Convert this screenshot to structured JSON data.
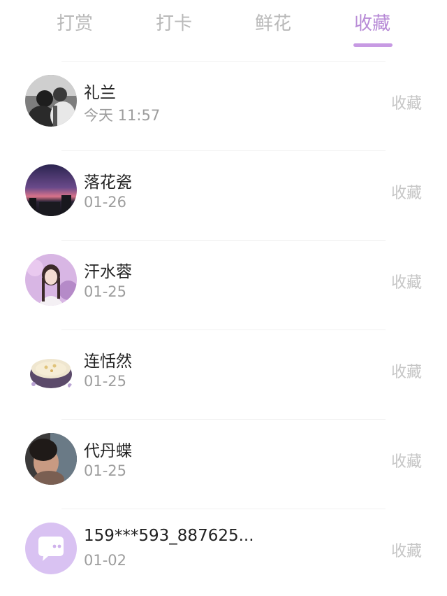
{
  "tabs": [
    {
      "label": "打赏",
      "active": false
    },
    {
      "label": "打卡",
      "active": false
    },
    {
      "label": "鲜花",
      "active": false
    },
    {
      "label": "收藏",
      "active": true
    }
  ],
  "colors": {
    "accent": "#c79ae3",
    "active_tab_text": "#b78ad6",
    "inactive_tab_text": "#b9b9b9",
    "name_text": "#222222",
    "date_text": "#9d9d9d",
    "action_text": "#c6c6c6"
  },
  "items": [
    {
      "name": "礼兰",
      "date": "今天 11:57",
      "action": "收藏",
      "avatar": "photo-couple-bw"
    },
    {
      "name": "落花瓷",
      "date": "01-26",
      "action": "收藏",
      "avatar": "photo-sunset-sky"
    },
    {
      "name": "汗水蓉",
      "date": "01-25",
      "action": "收藏",
      "avatar": "photo-girl-purple"
    },
    {
      "name": "连恬然",
      "date": "01-25",
      "action": "收藏",
      "avatar": "photo-dessert-bowl"
    },
    {
      "name": "代丹蝶",
      "date": "01-25",
      "action": "收藏",
      "avatar": "photo-person-dark"
    },
    {
      "name": "159***593_887625...",
      "date": "01-02",
      "action": "收藏",
      "avatar": "chat-bubble-icon"
    }
  ]
}
